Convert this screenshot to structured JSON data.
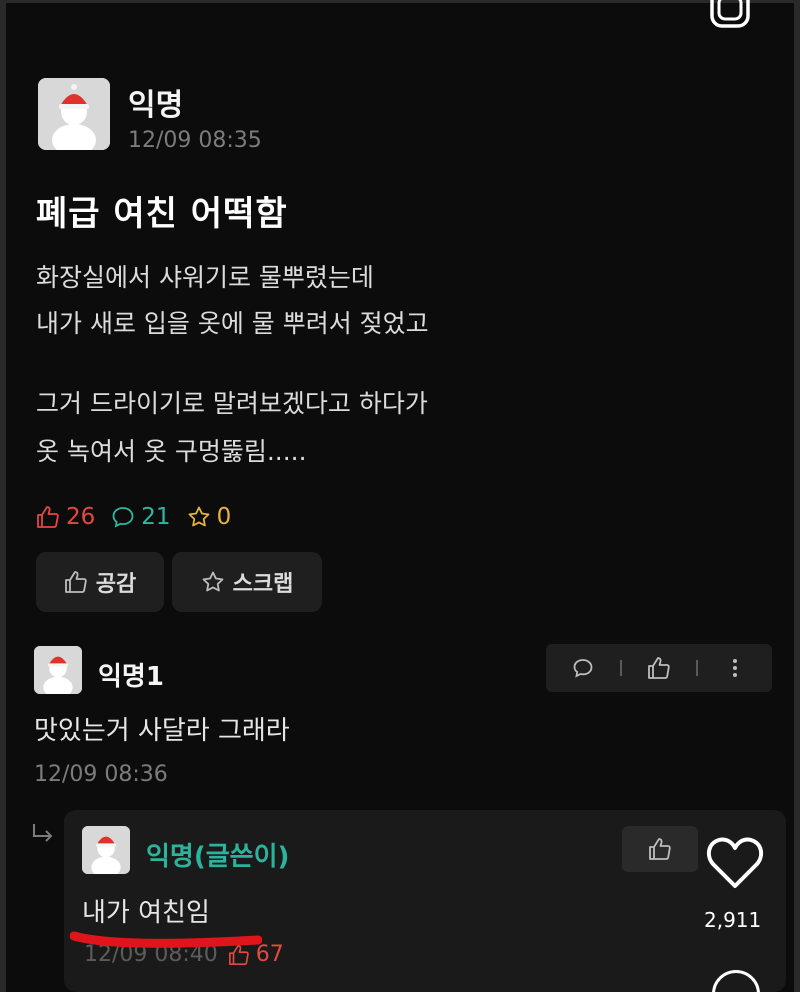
{
  "post": {
    "author": "익명",
    "time": "12/09 08:35",
    "title": "폐급 여친 어떡함",
    "body": [
      "화장실에서 샤워기로 물뿌렸는데",
      "내가 새로 입을 옷에 물 뿌려서 젖었고",
      "",
      "그거 드라이기로 말려보겠다고 하다가",
      "옷 녹여서 옷 구멍뚫림....."
    ],
    "stats": {
      "likes": "26",
      "comments": "21",
      "scraps": "0"
    },
    "buttons": {
      "like": "공감",
      "scrap": "스크랩"
    }
  },
  "comments": [
    {
      "author": "익명1",
      "text": "맛있는거 사달라 그래라",
      "time": "12/09 08:36"
    }
  ],
  "reply": {
    "author": "익명(글쓴이)",
    "text": "내가 여친임",
    "time": "12/09 08:40",
    "likes": "67"
  },
  "overlay": {
    "heart_count": "2,911"
  },
  "colors": {
    "background": "#0c0c0c",
    "like": "#e2493f",
    "comment": "#2fb7a2",
    "scrap": "#e6b43a",
    "reply_author": "#2bb39c",
    "underline": "#e0141b"
  }
}
